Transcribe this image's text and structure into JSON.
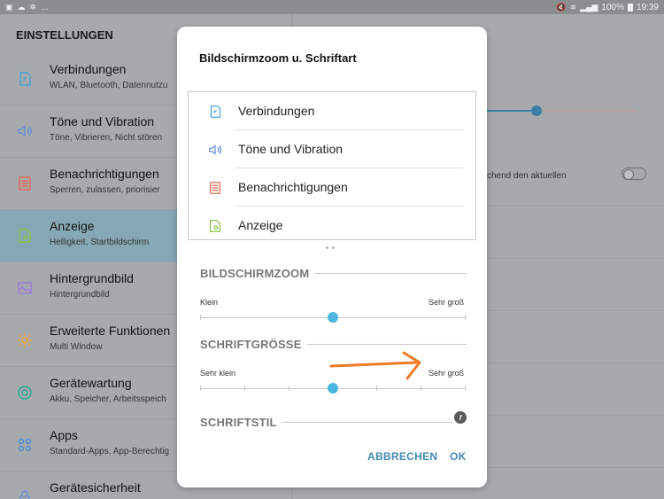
{
  "status_bar": {
    "time": "19:39",
    "battery": "100%",
    "left_icons": [
      "image-icon",
      "cloud-icon",
      "settings-icon"
    ],
    "left_ellipsis": "..."
  },
  "settings": {
    "title": "EINSTELLUNGEN",
    "items": [
      {
        "title": "Verbindungen",
        "subtitle": "WLAN, Bluetooth, Datennutzu",
        "icon": "connections-icon",
        "color": "#4aa3d8"
      },
      {
        "title": "Töne und Vibration",
        "subtitle": "Töne, Vibrieren, Nicht stören",
        "icon": "speaker-icon",
        "color": "#6b8fd6"
      },
      {
        "title": "Benachrichtigungen",
        "subtitle": "Sperren, zulassen, priorisier",
        "icon": "notifications-icon",
        "color": "#e06b5a"
      },
      {
        "title": "Anzeige",
        "subtitle": "Helligkeit, Startbildschirm",
        "icon": "display-icon",
        "color": "#8bc34a",
        "active": true
      },
      {
        "title": "Hintergrundbild",
        "subtitle": "Hintergrundbild",
        "icon": "wallpaper-icon",
        "color": "#9c7bd6"
      },
      {
        "title": "Erweiterte Funktionen",
        "subtitle": "Multi Window",
        "icon": "advanced-gear-icon",
        "color": "#f0a732"
      },
      {
        "title": "Gerätewartung",
        "subtitle": "Akku, Speicher, Arbeitsspeich",
        "icon": "maintenance-icon",
        "color": "#26a69a"
      },
      {
        "title": "Apps",
        "subtitle": "Standard-Apps, App-Berechtig",
        "icon": "apps-icon",
        "color": "#4a8fd6"
      },
      {
        "title": "Gerätesicherheit",
        "subtitle": "",
        "icon": "lock-icon",
        "color": "#6b8fd6"
      }
    ],
    "right_text": "chend den aktuellen",
    "right_slider_value": 0.34
  },
  "dialog": {
    "title": "Bildschirmzoom u. Schriftart",
    "preview_items": [
      {
        "label": "Verbindungen",
        "icon": "connections-icon",
        "color": "#4aa3d8"
      },
      {
        "label": "Töne und Vibration",
        "icon": "speaker-icon",
        "color": "#6b8fd6"
      },
      {
        "label": "Benachrichtigungen",
        "icon": "notifications-icon",
        "color": "#e06b5a"
      },
      {
        "label": "Anzeige",
        "icon": "display-icon",
        "color": "#8bc34a"
      }
    ],
    "zoom": {
      "heading": "BILDSCHIRMZOOM",
      "min_label": "Klein",
      "max_label": "Sehr groß",
      "steps": 3,
      "value": 1
    },
    "font_size": {
      "heading": "SCHRIFTGRÖSSE",
      "min_label": "Sehr klein",
      "max_label": "Sehr groß",
      "steps": 7,
      "value": 3
    },
    "font_style": {
      "heading": "SCHRIFTSTIL",
      "icon": "font-style-icon"
    },
    "cancel_label": "ABBRECHEN",
    "ok_label": "OK",
    "accent": "#4db6e0",
    "button_color": "#3f8bb3"
  },
  "annotation": {
    "arrow_color": "#f07a22"
  }
}
